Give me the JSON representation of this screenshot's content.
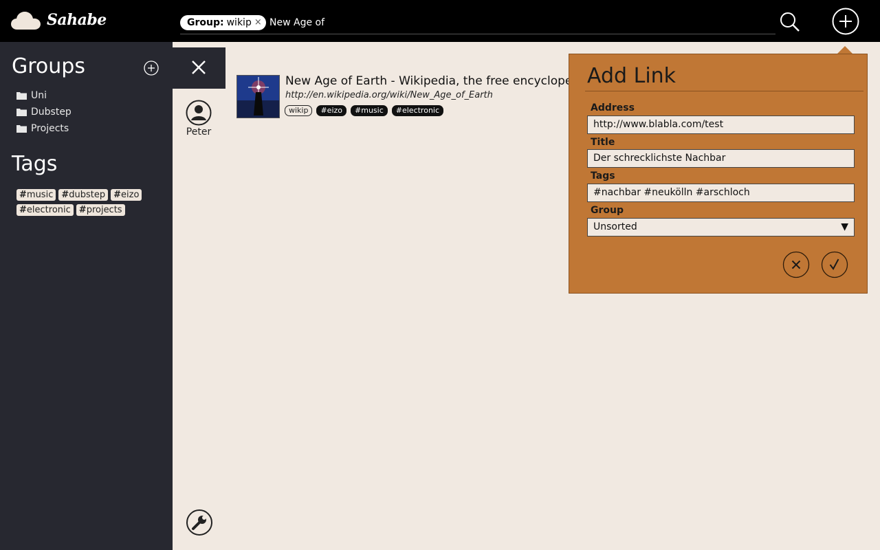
{
  "app": {
    "name": "Sahabe"
  },
  "search": {
    "group_prefix": "Group:",
    "group_value": "wikip",
    "chip_remove": "×",
    "query": "New Age of"
  },
  "sidebar": {
    "groups_title": "Groups",
    "groups": [
      {
        "label": "Uni"
      },
      {
        "label": "Dubstep"
      },
      {
        "label": "Projects"
      }
    ],
    "tags_title": "Tags",
    "tags": [
      {
        "label": "music"
      },
      {
        "label": "dubstep"
      },
      {
        "label": "eizo"
      },
      {
        "label": "electronic"
      },
      {
        "label": "projects"
      }
    ]
  },
  "user": {
    "name": "Peter"
  },
  "result": {
    "title": "New Age of Earth - Wikipedia, the free encyclopedia",
    "url": "http://en.wikipedia.org/wiki/New_Age_of_Earth",
    "tags": [
      {
        "label": "wikip",
        "style": "outline"
      },
      {
        "label": "#eizo",
        "style": "filled"
      },
      {
        "label": "#music",
        "style": "filled"
      },
      {
        "label": "#electronic",
        "style": "filled"
      }
    ]
  },
  "add_link": {
    "title": "Add Link",
    "address_label": "Address",
    "address_value": "http://www.blabla.com/test",
    "title_label": "Title",
    "title_value": "Der schrecklichste Nachbar",
    "tags_label": "Tags",
    "tags_value": "#nachbar #neukölln #arschloch",
    "group_label": "Group",
    "group_value": "Unsorted",
    "select_arrow": "▼"
  },
  "colors": {
    "topbar": "#000000",
    "sidebar": "#272830",
    "content_bg": "#f1e9e1",
    "popup_bg": "#c07735"
  }
}
